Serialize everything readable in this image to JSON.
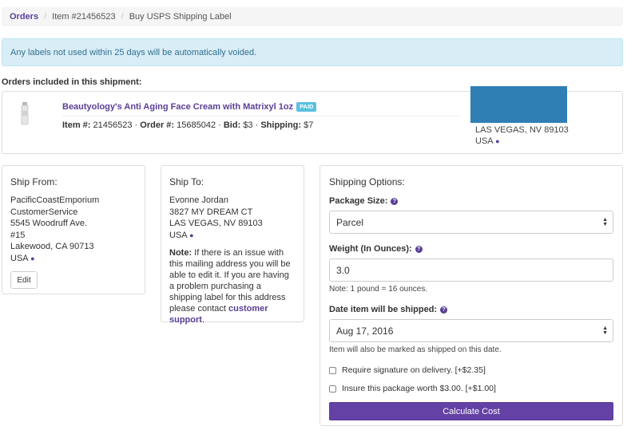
{
  "breadcrumb": {
    "orders": "Orders",
    "item": "Item #21456523",
    "current": "Buy USPS Shipping Label"
  },
  "alert": "Any labels not used within 25 days will be automatically voided.",
  "orders_heading": "Orders included in this shipment:",
  "order": {
    "title": "Beautyology's Anti Aging Face Cream with Matrixyl 1oz",
    "badge": "PAID",
    "item_label": "Item #:",
    "item_value": "21456523",
    "order_label": "Order #:",
    "order_value": "15685042",
    "bid_label": "Bid:",
    "bid_value": "$3",
    "shipping_label": "Shipping:",
    "shipping_value": "$7",
    "address_line": "LAS VEGAS, NV 89103",
    "country": "USA"
  },
  "ship_from": {
    "title": "Ship From:",
    "lines": [
      "PacificCoastEmporium",
      "CustomerService",
      "5545 Woodruff Ave.",
      "#15",
      "Lakewood, CA 90713"
    ],
    "country": "USA",
    "edit_label": "Edit"
  },
  "ship_to": {
    "title": "Ship To:",
    "lines": [
      "Evonne Jordan",
      "3827 MY DREAM CT",
      "LAS VEGAS, NV 89103"
    ],
    "country": "USA",
    "note_label": "Note:",
    "note_text": "If there is an issue with this mailing address you will be able to edit it. If you are having a problem purchasing a shipping label for this address please contact",
    "note_link": "customer support",
    "note_end": "."
  },
  "shipping_options": {
    "title": "Shipping Options:",
    "package_label": "Package Size:",
    "package_value": "Parcel",
    "weight_label": "Weight (In Ounces):",
    "weight_value": "3.0",
    "weight_note": "Note: 1 pound = 16 ounces.",
    "date_label": "Date item will be shipped:",
    "date_value": "Aug 17, 2016",
    "date_note": "Item will also be marked as shipped on this date.",
    "signature_label": "Require signature on delivery. [+$2.35]",
    "insure_label": "Insure this package worth $3.00. [+$1.00]",
    "calculate_label": "Calculate Cost"
  },
  "icons": {
    "question": "?",
    "map_marker": "map-marker-icon"
  },
  "colors": {
    "brand_purple": "#6441a5",
    "link_purple": "#5b3e96",
    "alert_bg": "#d9edf7",
    "alert_text": "#31708f",
    "badge_blue": "#5bc0de",
    "redacted_blue": "#2f7fb5"
  }
}
